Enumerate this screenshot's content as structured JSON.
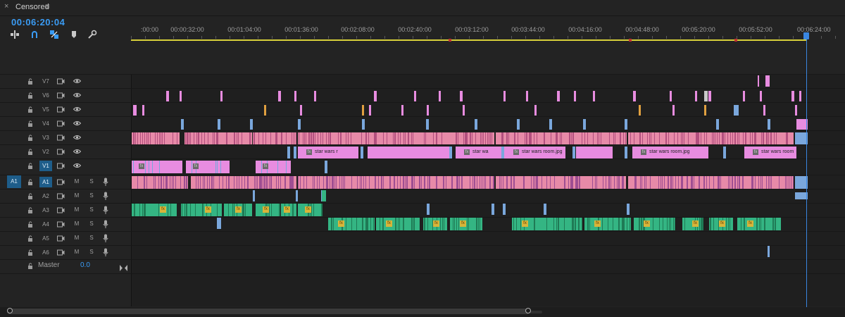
{
  "panel": {
    "title": "Censored",
    "close_glyph": "×",
    "menu_glyph": "≡"
  },
  "timecode": "00:06:20:04",
  "tools": [
    "insert-edit-icon",
    "snap-icon",
    "linked-selection-icon",
    "add-marker-icon",
    "settings-wrench-icon"
  ],
  "ruler": {
    "labels": [
      ":00:00",
      "00:00:32:00",
      "00:01:04:00",
      "00:01:36:00",
      "00:02:08:00",
      "00:02:40:00",
      "00:03:12:00",
      "00:03:44:00",
      "00:04:16:00",
      "00:04:48:00",
      "00:05:20:00",
      "00:05:52:00",
      "00:06:24:00"
    ]
  },
  "video_tracks": [
    "V7",
    "V6",
    "V5",
    "V4",
    "V3",
    "V2",
    "V1"
  ],
  "audio_tracks": [
    "A1",
    "A2",
    "A3",
    "A4",
    "A5",
    "A6"
  ],
  "source_patch": "A1",
  "mute_label": "M",
  "solo_label": "S",
  "master": {
    "label": "Master",
    "value": "0.0"
  },
  "clip_labels": {
    "v2": [
      "star wars r",
      "star wa",
      "star wars room.jpg",
      "star wars room.jpg",
      "star wars room"
    ]
  },
  "colors": {
    "accent": "#3a9cf5",
    "video_clip": "#e88ce0",
    "dense_clip": "#e78aa8",
    "audio_clip": "#34b583",
    "adjustment": "#7aa7dc",
    "yellow_bar": "#d7cf3a",
    "playhead": "#3a86e0"
  }
}
